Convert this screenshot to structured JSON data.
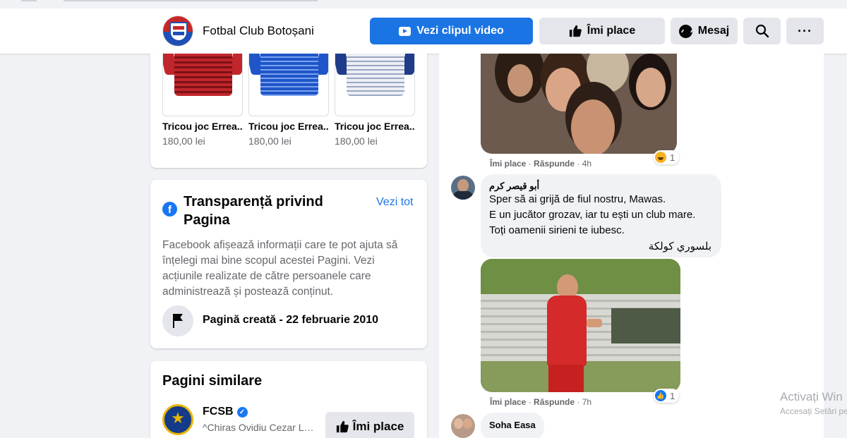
{
  "header": {
    "page_name": "Fotbal Club Botoșani",
    "video_button": "Vezi clipul video",
    "like_button": "Îmi place",
    "message_button": "Mesaj",
    "more_button": "···"
  },
  "shop": {
    "products": [
      {
        "name": "Tricou joc Errea...",
        "price": "180,00 lei",
        "color": "#c0262b"
      },
      {
        "name": "Tricou joc Errea...",
        "price": "180,00 lei",
        "color": "#1f55c9"
      },
      {
        "name": "Tricou joc Errea...",
        "price": "180,00 lei",
        "color": "#dfe3ea"
      }
    ]
  },
  "transparency": {
    "title": "Transparență privind Pagina",
    "see_all": "Vezi tot",
    "description": "Facebook afișează informații care te pot ajuta să înțelegi mai bine scopul acestei Pagini. Vezi acțiunile realizate de către persoanele care administrează și postează conținut.",
    "created": "Pagină creată - 22 februarie 2010"
  },
  "similar": {
    "title": "Pagini similare",
    "page_name": "FCSB",
    "page_sub": "^Chiras Ovidiu Cezar Lu...",
    "like_button": "Îmi place"
  },
  "comments": [
    {
      "meta_like": "Îmi place",
      "meta_reply": "Răspunde",
      "meta_time": "4h",
      "reaction_count": "1"
    },
    {
      "author": "أبو قيصر كرم",
      "lines": [
        "Sper să ai grijă de fiul nostru, Mawas.",
        "E un jucător grozav, iar tu ești un club mare.",
        "Toți oamenii sirieni te iubesc.",
        "بلسوري كولكة"
      ],
      "meta_like": "Îmi place",
      "meta_reply": "Răspunde",
      "meta_time": "7h",
      "reaction_count": "1"
    },
    {
      "author": "Soha Easa"
    }
  ],
  "windows_watermark": {
    "line1": "Activați Win",
    "line2": "Accesați Setări pe"
  },
  "colors": {
    "accent": "#1b74e4",
    "background": "#f0f2f5"
  }
}
